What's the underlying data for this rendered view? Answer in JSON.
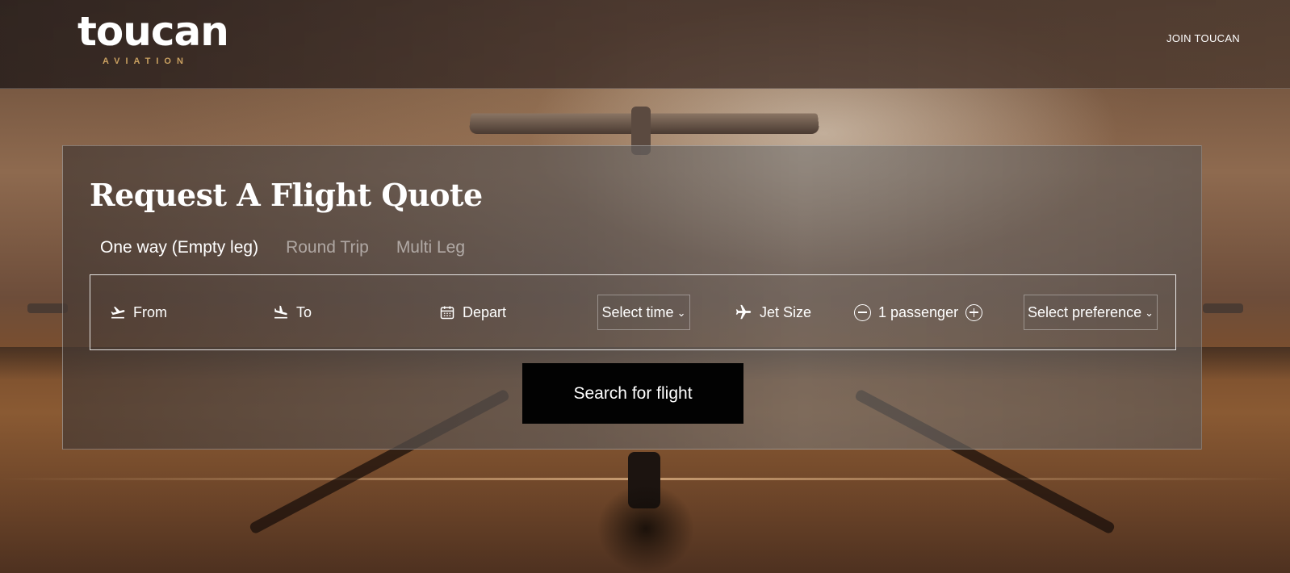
{
  "header": {
    "logo_text": "toucan",
    "logo_subtext": "AVIATION",
    "join_label": "JOIN TOUCAN"
  },
  "quote": {
    "title": "Request A Flight Quote",
    "tabs": [
      {
        "label": "One way (Empty leg)",
        "active": true
      },
      {
        "label": "Round Trip",
        "active": false
      },
      {
        "label": "Multi Leg",
        "active": false
      }
    ],
    "fields": {
      "from_label": "From",
      "to_label": "To",
      "depart_label": "Depart",
      "time_select": "Select time",
      "jet_size_label": "Jet Size",
      "passengers": "1 passenger",
      "preference_select": "Select preference"
    },
    "search_label": "Search for flight"
  },
  "icons": {
    "from": "plane-takeoff-icon",
    "to": "plane-landing-icon",
    "depart": "calendar-icon",
    "jet_size": "airplane-icon",
    "decrement": "minus-circle-icon",
    "increment": "plus-circle-icon",
    "dropdown": "chevron-down-icon"
  },
  "colors": {
    "accent_gold": "#c9a060",
    "button_bg": "#020202"
  }
}
